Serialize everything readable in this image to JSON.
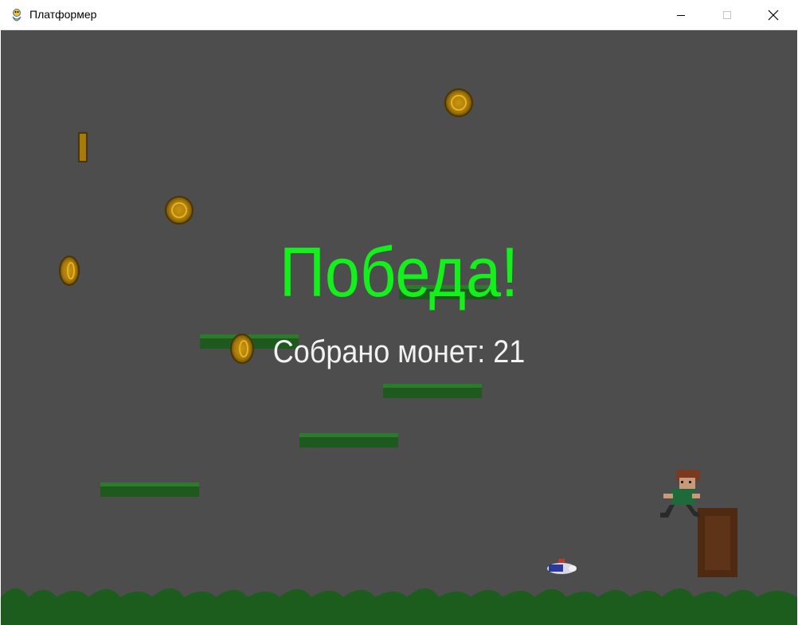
{
  "window": {
    "title": "Платформер",
    "icon": "pygame-snake-icon",
    "controls": [
      "minimize-icon",
      "maximize-icon",
      "close-icon"
    ]
  },
  "game": {
    "background_color": "#4d4d4d",
    "victory_title": "Победа!",
    "coins_message": "Собрано монет: 21",
    "coins_collected": 21,
    "colors": {
      "title": "#14f01c",
      "message": "#f2f2f2",
      "coin": "#d4a017",
      "grass": "#1e6b1e",
      "crate": "#5a2f14"
    }
  }
}
